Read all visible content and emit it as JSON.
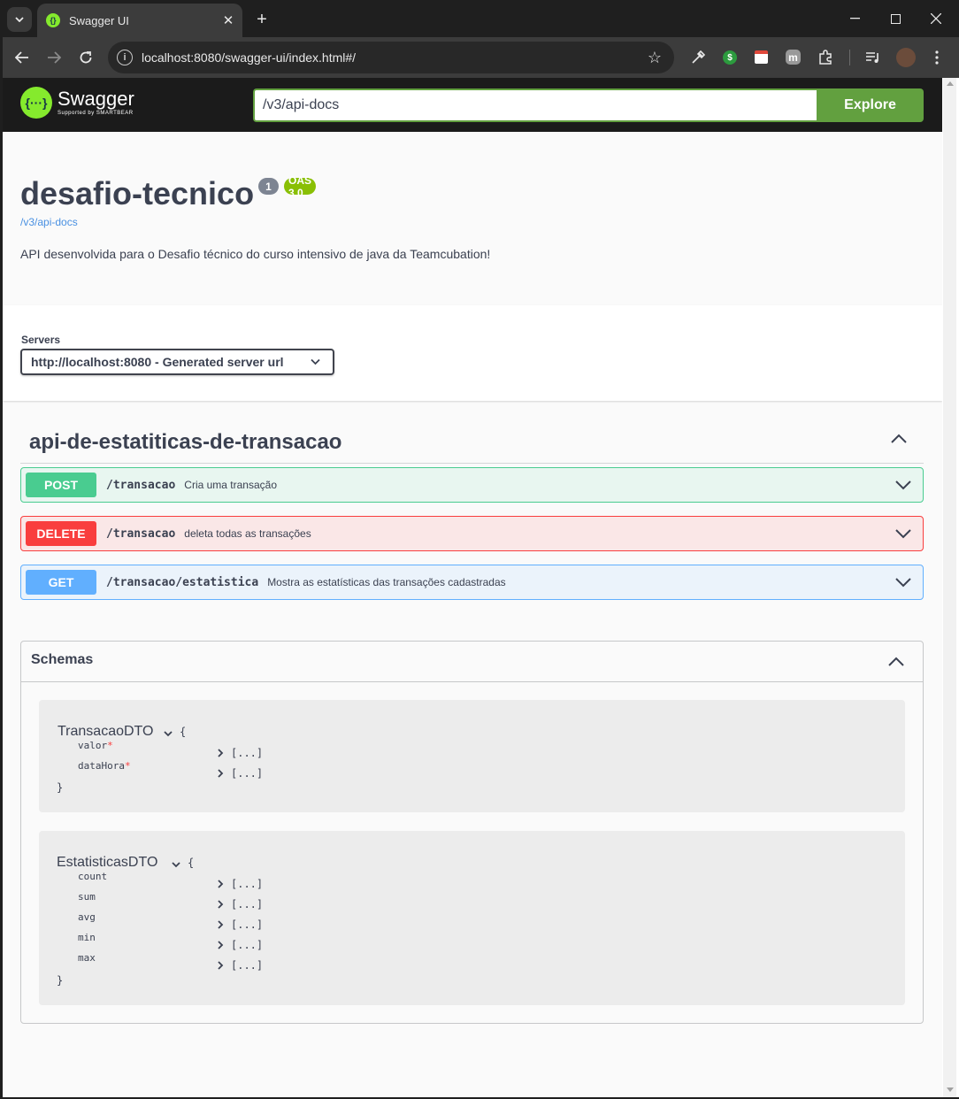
{
  "browser": {
    "tab_title": "Swagger UI",
    "url": "localhost:8080/swagger-ui/index.html#/"
  },
  "swagger": {
    "logo_name": "Swagger",
    "logo_sub": "Supported by SMARTBEAR",
    "spec_url_value": "/v3/api-docs",
    "explore_label": "Explore",
    "accent_color": "#85ea2d"
  },
  "info": {
    "title": "desafio-tecnico",
    "version": "1",
    "oas_badge": "OAS 3.0",
    "docs_link": "/v3/api-docs",
    "description": "API desenvolvida para o Desafio técnico do curso intensivo de java da Teamcubation!"
  },
  "servers": {
    "label": "Servers",
    "selected": "http://localhost:8080 - Generated server url"
  },
  "tag": {
    "name": "api-de-estatiticas-de-transacao",
    "operations": [
      {
        "method": "POST",
        "path": "/transacao",
        "summary": "Cria uma transação",
        "color": "#49cc90"
      },
      {
        "method": "DELETE",
        "path": "/transacao",
        "summary": "deleta todas as transações",
        "color": "#f93e3e"
      },
      {
        "method": "GET",
        "path": "/transacao/estatistica",
        "summary": "Mostra as estatísticas das transações cadastradas",
        "color": "#61affe"
      }
    ]
  },
  "schemas": {
    "title": "Schemas",
    "models": [
      {
        "name": "TransacaoDTO",
        "open_brace": "{",
        "close_brace": "}",
        "props": [
          {
            "name": "valor",
            "required": "*",
            "value": "[...]"
          },
          {
            "name": "dataHora",
            "required": "*",
            "value": "[...]"
          }
        ]
      },
      {
        "name": "EstatisticasDTO",
        "open_brace": "{",
        "close_brace": "}",
        "props": [
          {
            "name": "count",
            "value": "[...]"
          },
          {
            "name": "sum",
            "value": "[...]"
          },
          {
            "name": "avg",
            "value": "[...]"
          },
          {
            "name": "min",
            "value": "[...]"
          },
          {
            "name": "max",
            "value": "[...]"
          }
        ]
      }
    ]
  }
}
